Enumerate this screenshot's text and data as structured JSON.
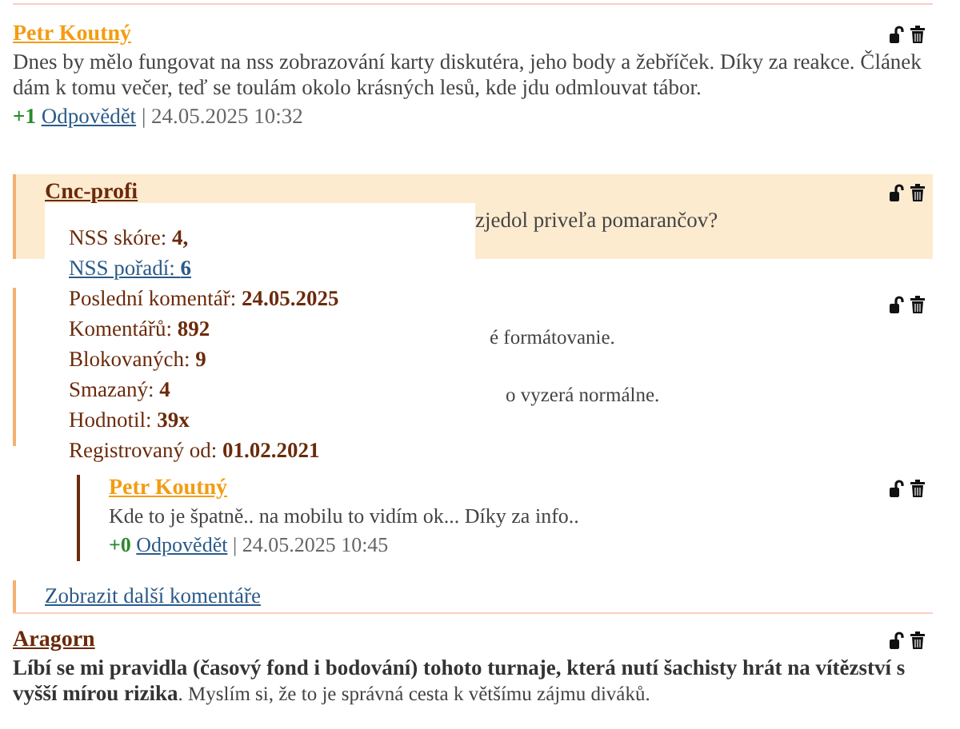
{
  "first_comment": {
    "author": "Petr Koutný",
    "color": "#f39c12",
    "text": "Dnes by mělo fungovat na nss zobrazování karty diskutéra, jeho body a žebříček. Díky za reakce. Článek dám k tomu večer, teď se toulám okolo krásných lesů, kde jdu odmlouvat tábor.",
    "votes": "+1",
    "reply": "Odpovědět",
    "date": "| 24.05.2025 10:32"
  },
  "thread": {
    "author": "Cnc-profi",
    "color": "#6b2a0a",
    "highlighted": true,
    "text": "zjedol priveľa pomarančov?"
  },
  "hidden_reply": {
    "fragments": [
      "é formátovanie.",
      "o vyzerá normálne."
    ],
    "children": [
      {
        "author": "Petr Koutný",
        "color": "#f39c12",
        "text": "Kde to je špatně.. na mobilu to vidím ok... Díky za info..",
        "votes": "+0",
        "reply": "Odpovědět",
        "date": "| 24.05.2025 10:45"
      }
    ]
  },
  "profile_card": {
    "rows": [
      {
        "label": "NSS skóre:",
        "value": "4,",
        "kind": "text"
      },
      {
        "label": "NSS pořadí:",
        "value": "6",
        "kind": "link"
      },
      {
        "label": "Poslední komentář:",
        "value": "24.05.2025",
        "kind": "text"
      },
      {
        "label": "Komentářů:",
        "value": "892",
        "kind": "text"
      },
      {
        "label": "Blokovaných:",
        "value": "9",
        "kind": "text"
      },
      {
        "label": "Smazaný:",
        "value": "4",
        "kind": "text"
      },
      {
        "label": "Hodnotil:",
        "value": "39x",
        "kind": "text"
      },
      {
        "label": "Registrovaný od:",
        "value": "01.02.2021",
        "kind": "text"
      }
    ]
  },
  "more_link": "Zobrazit další komentáře",
  "last_comment": {
    "author": "Aragorn",
    "color": "#6b2a0a",
    "text": "**Líbí se mi pravidla (časový fond i bodování) tohoto turnaje, která nutí šachisty hrát na vítězství s vyšší mírou rizika**. Myslím si, že to je správná cesta k většímu zájmu diváků."
  }
}
